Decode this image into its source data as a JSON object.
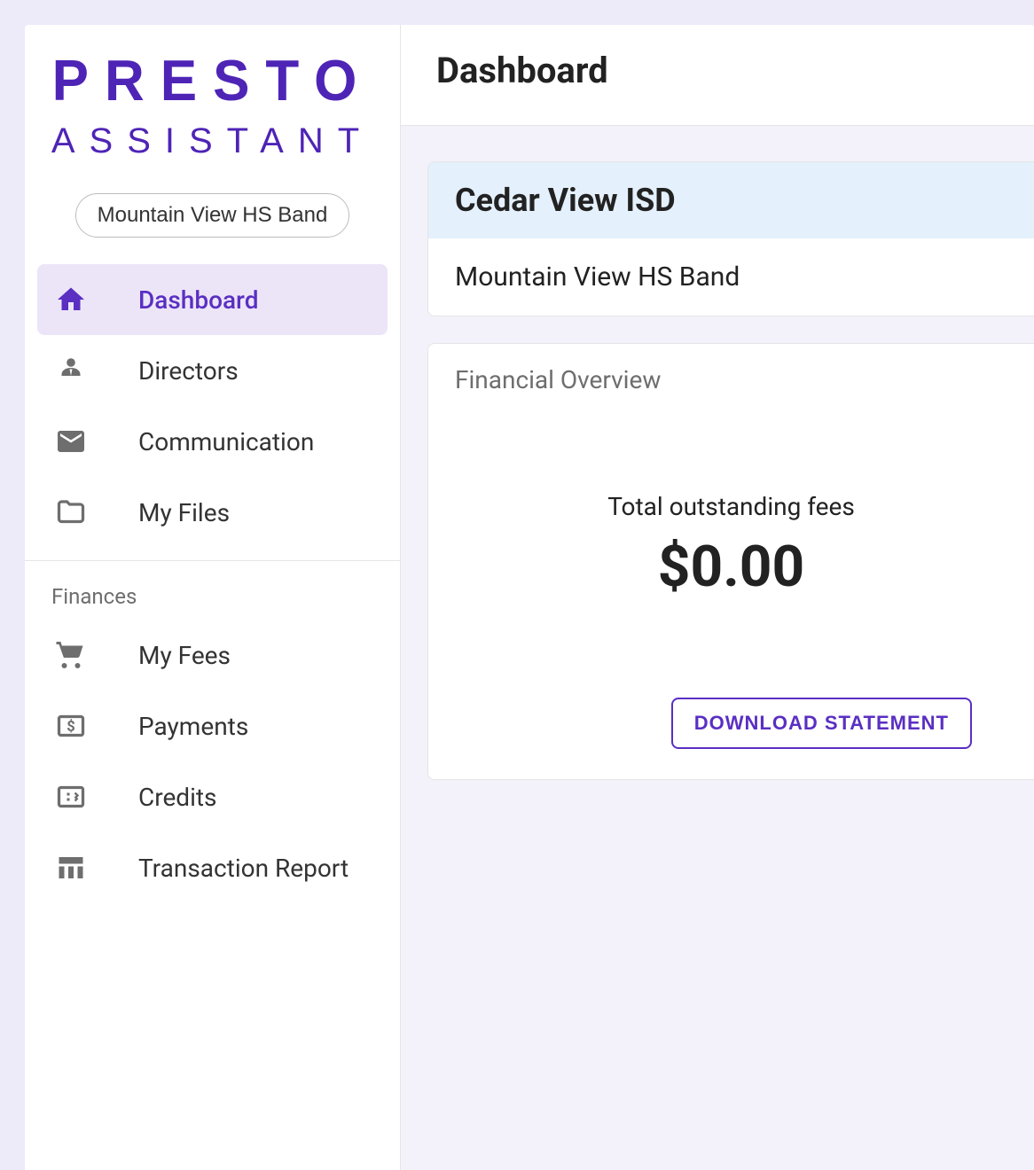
{
  "brand": {
    "line1": "PRESTO",
    "line2": "ASSISTANT"
  },
  "org_chip": "Mountain View HS Band",
  "nav": {
    "items": [
      {
        "label": "Dashboard"
      },
      {
        "label": "Directors"
      },
      {
        "label": "Communication"
      },
      {
        "label": "My Files"
      }
    ],
    "finances_section_label": "Finances",
    "finance_items": [
      {
        "label": "My Fees"
      },
      {
        "label": "Payments"
      },
      {
        "label": "Credits"
      },
      {
        "label": "Transaction Report"
      }
    ]
  },
  "topbar": {
    "title": "Dashboard"
  },
  "header_panel": {
    "district": "Cedar View ISD",
    "organization": "Mountain View HS Band"
  },
  "financial_overview": {
    "title": "Financial Overview",
    "fees_label": "Total outstanding fees",
    "fees_amount": "$0.00",
    "download_label": "DOWNLOAD STATEMENT"
  }
}
